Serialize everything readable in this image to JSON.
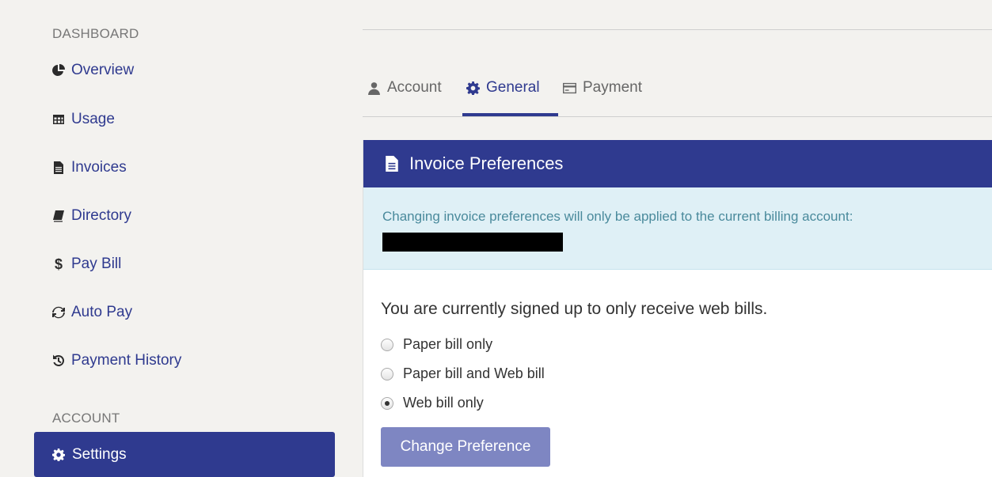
{
  "sidebar": {
    "dashboard_heading": "DASHBOARD",
    "items": [
      {
        "label": "Overview",
        "icon": "pie-chart-icon"
      },
      {
        "label": "Usage",
        "icon": "table-icon"
      },
      {
        "label": "Invoices",
        "icon": "document-icon"
      },
      {
        "label": "Directory",
        "icon": "book-icon"
      },
      {
        "label": "Pay Bill",
        "icon": "dollar-icon"
      },
      {
        "label": "Auto Pay",
        "icon": "refresh-icon"
      },
      {
        "label": "Payment History",
        "icon": "history-icon"
      }
    ],
    "account_heading": "ACCOUNT",
    "active_item": {
      "label": "Settings",
      "icon": "gear-icon"
    }
  },
  "tabs": [
    {
      "label": "Account",
      "icon": "user-icon"
    },
    {
      "label": "General",
      "icon": "gear-icon",
      "active": true
    },
    {
      "label": "Payment",
      "icon": "credit-card-icon"
    }
  ],
  "panel": {
    "title": "Invoice Preferences",
    "alert_text": "Changing invoice preferences will only be applied to the current billing account:",
    "status_text": "You are currently signed up to only receive web bills.",
    "options": [
      {
        "label": "Paper bill only",
        "selected": false
      },
      {
        "label": "Paper bill and Web bill",
        "selected": false
      },
      {
        "label": "Web bill only",
        "selected": true
      }
    ],
    "button_label": "Change Preference"
  },
  "colors": {
    "primary": "#2f3a8f",
    "button": "#7e86c2",
    "alert_bg": "#dff0f6",
    "alert_text": "#4a8a9c"
  }
}
